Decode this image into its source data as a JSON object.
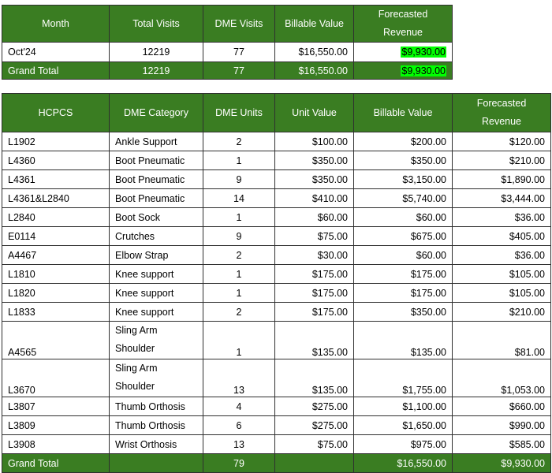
{
  "summary": {
    "headers": [
      "Month",
      "Total Visits",
      "DME Visits",
      "Billable Value",
      "Forecasted Revenue"
    ],
    "row": {
      "month": "Oct'24",
      "total_visits": "12219",
      "dme_visits": "77",
      "billable_value": "$16,550.00",
      "forecasted_revenue": "$9,930.00"
    },
    "grand_total": {
      "label": "Grand Total",
      "total_visits": "12219",
      "dme_visits": "77",
      "billable_value": "$16,550.00",
      "forecasted_revenue": "$9,930.00"
    }
  },
  "detail": {
    "headers": [
      "HCPCS",
      "DME Category",
      "DME Units",
      "Unit Value",
      "Billable Value",
      "Forecasted Revenue"
    ],
    "rows": [
      {
        "hcpcs": "L1902",
        "category": "Ankle Support",
        "units": "2",
        "unit_value": "$100.00",
        "billable": "$200.00",
        "forecast": "$120.00"
      },
      {
        "hcpcs": "L4360",
        "category": "Boot Pneumatic",
        "units": "1",
        "unit_value": "$350.00",
        "billable": "$350.00",
        "forecast": "$210.00"
      },
      {
        "hcpcs": "L4361",
        "category": "Boot Pneumatic",
        "units": "9",
        "unit_value": "$350.00",
        "billable": "$3,150.00",
        "forecast": "$1,890.00"
      },
      {
        "hcpcs": "L4361&L2840",
        "category": "Boot Pneumatic",
        "units": "14",
        "unit_value": "$410.00",
        "billable": "$5,740.00",
        "forecast": "$3,444.00"
      },
      {
        "hcpcs": "L2840",
        "category": "Boot Sock",
        "units": "1",
        "unit_value": "$60.00",
        "billable": "$60.00",
        "forecast": "$36.00"
      },
      {
        "hcpcs": "E0114",
        "category": "Crutches",
        "units": "9",
        "unit_value": "$75.00",
        "billable": "$675.00",
        "forecast": "$405.00"
      },
      {
        "hcpcs": "A4467",
        "category": "Elbow Strap",
        "units": "2",
        "unit_value": "$30.00",
        "billable": "$60.00",
        "forecast": "$36.00"
      },
      {
        "hcpcs": "L1810",
        "category": "Knee support",
        "units": "1",
        "unit_value": "$175.00",
        "billable": "$175.00",
        "forecast": "$105.00"
      },
      {
        "hcpcs": "L1820",
        "category": "Knee support",
        "units": "1",
        "unit_value": "$175.00",
        "billable": "$175.00",
        "forecast": "$105.00"
      },
      {
        "hcpcs": "L1833",
        "category": "Knee support",
        "units": "2",
        "unit_value": "$175.00",
        "billable": "$350.00",
        "forecast": "$210.00"
      },
      {
        "hcpcs": "A4565",
        "category": "Sling Arm Shoulder",
        "units": "1",
        "unit_value": "$135.00",
        "billable": "$135.00",
        "forecast": "$81.00"
      },
      {
        "hcpcs": "L3670",
        "category": "Sling Arm Shoulder",
        "units": "13",
        "unit_value": "$135.00",
        "billable": "$1,755.00",
        "forecast": "$1,053.00"
      },
      {
        "hcpcs": "L3807",
        "category": "Thumb Orthosis",
        "units": "4",
        "unit_value": "$275.00",
        "billable": "$1,100.00",
        "forecast": "$660.00"
      },
      {
        "hcpcs": "L3809",
        "category": "Thumb Orthosis",
        "units": "6",
        "unit_value": "$275.00",
        "billable": "$1,650.00",
        "forecast": "$990.00"
      },
      {
        "hcpcs": "L3908",
        "category": "Wrist Orthosis",
        "units": "13",
        "unit_value": "$75.00",
        "billable": "$975.00",
        "forecast": "$585.00"
      }
    ],
    "grand_total": {
      "label": "Grand Total",
      "units": "79",
      "billable": "$16,550.00",
      "forecast": "$9,930.00"
    }
  },
  "colors": {
    "header_green": "#3a7d22",
    "highlight": "#00ff00"
  }
}
